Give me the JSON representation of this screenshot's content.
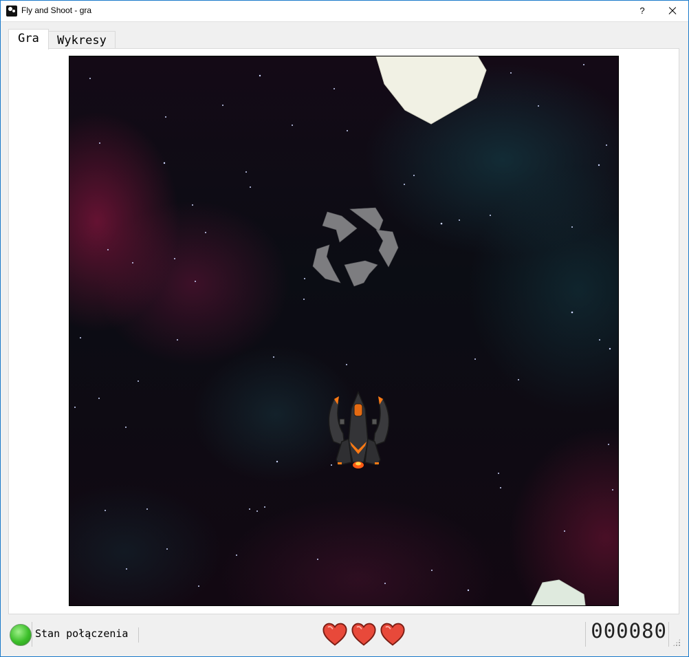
{
  "window": {
    "title": "Fly and Shoot - gra",
    "help_label": "?"
  },
  "tabs": [
    {
      "label": "Gra",
      "active": true
    },
    {
      "label": "Wykresy",
      "active": false
    }
  ],
  "status_bar": {
    "connection_label": "Stan połączenia",
    "connection_color": "#3cbf2a",
    "lives": 3,
    "heart_color": "#e8493a",
    "score": "000080"
  }
}
